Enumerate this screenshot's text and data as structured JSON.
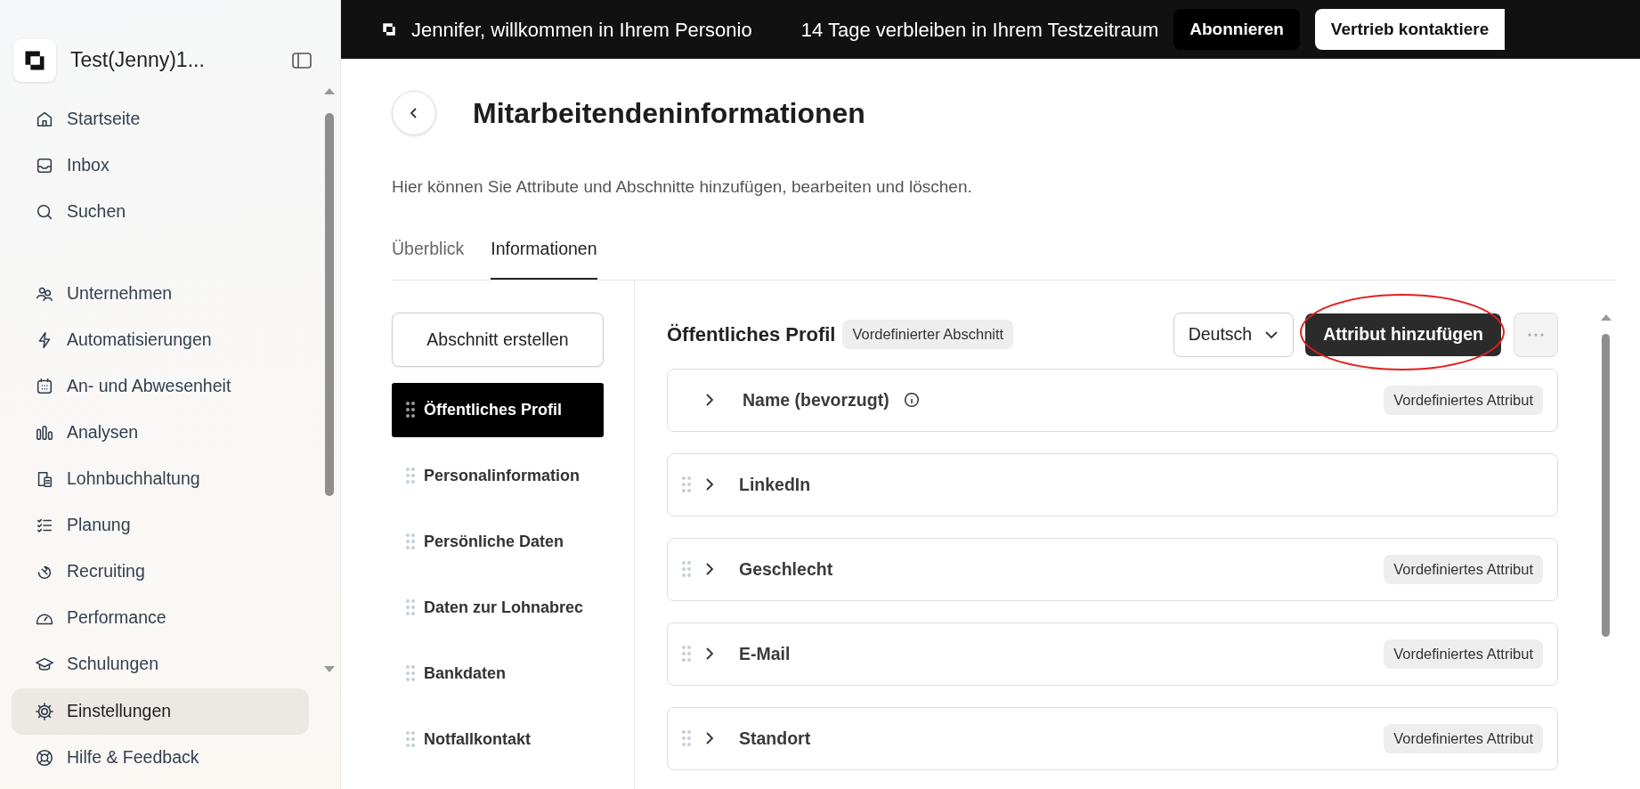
{
  "workspace": {
    "name": "Test(Jenny)1..."
  },
  "sidebar": {
    "groups": [
      [
        {
          "label": "Startseite",
          "selected": false
        },
        {
          "label": "Inbox",
          "selected": false
        },
        {
          "label": "Suchen",
          "selected": false
        }
      ],
      [
        {
          "label": "Unternehmen",
          "selected": false
        },
        {
          "label": "Automatisierungen",
          "selected": false
        },
        {
          "label": "An- und Abwesenheit",
          "selected": false
        },
        {
          "label": "Analysen",
          "selected": false
        },
        {
          "label": "Lohnbuchhaltung",
          "selected": false
        },
        {
          "label": "Planung",
          "selected": false
        },
        {
          "label": "Recruiting",
          "selected": false
        },
        {
          "label": "Performance",
          "selected": false
        },
        {
          "label": "Schulungen",
          "selected": false
        }
      ]
    ],
    "footer_items": [
      {
        "label": "Einstellungen",
        "selected": true
      },
      {
        "label": "Hilfe & Feedback",
        "selected": false
      }
    ]
  },
  "banner": {
    "greeting": "Jennifer, willkommen in Ihrem Personio",
    "trial_notice": "14 Tage verbleiben in Ihrem Testzeitraum",
    "buttons": [
      {
        "label": "Abonnieren",
        "kind": "dark"
      },
      {
        "label": "Vertrieb kontaktiere",
        "kind": "light"
      }
    ]
  },
  "page": {
    "title": "Mitarbeitendeninformationen",
    "description": "Hier können Sie Attribute und Abschnitte hinzufügen, bearbeiten und löschen.",
    "tabs": [
      {
        "label": "Überblick",
        "selected": false
      },
      {
        "label": "Informationen",
        "selected": true
      }
    ]
  },
  "sections": {
    "create_button": "Abschnitt erstellen",
    "items": [
      {
        "label": "Öffentliches Profil",
        "selected": true
      },
      {
        "label": "Personalinformation",
        "selected": false
      },
      {
        "label": "Persönliche Daten",
        "selected": false
      },
      {
        "label": "Daten zur Lohnabrec",
        "selected": false
      },
      {
        "label": "Bankdaten",
        "selected": false
      },
      {
        "label": "Notfallkontakt",
        "selected": false
      }
    ]
  },
  "section_panel": {
    "title": "Öffentliches Profil",
    "badge": "Vordefinierter Abschnitt",
    "language": "Deutsch",
    "add_button": "Attribut hinzufügen",
    "highlight": {
      "kind": "ellipse"
    },
    "attributes": [
      {
        "name": "Name (bevorzugt)",
        "info": true,
        "draggable": false,
        "badge": "Vordefiniertes Attribut"
      },
      {
        "name": "LinkedIn",
        "info": false,
        "draggable": true
      },
      {
        "name": "Geschlecht",
        "info": false,
        "draggable": true,
        "badge": "Vordefiniertes Attribut"
      },
      {
        "name": "E-Mail",
        "info": false,
        "draggable": true,
        "badge": "Vordefiniertes Attribut"
      },
      {
        "name": "Standort",
        "info": false,
        "draggable": true,
        "badge": "Vordefiniertes Attribut"
      }
    ]
  }
}
